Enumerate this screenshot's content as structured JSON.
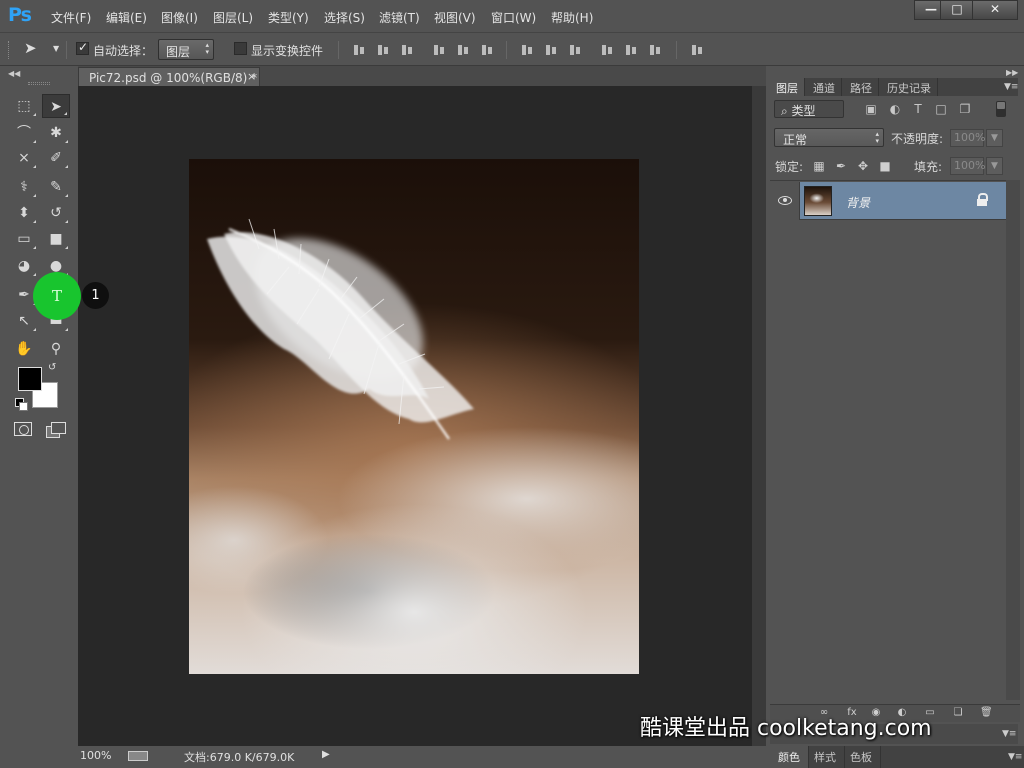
{
  "app": {
    "logo": "Ps"
  },
  "menu": [
    "文件(F)",
    "编辑(E)",
    "图像(I)",
    "图层(L)",
    "类型(Y)",
    "选择(S)",
    "滤镜(T)",
    "视图(V)",
    "窗口(W)",
    "帮助(H)"
  ],
  "window_controls": {
    "minimize": "—",
    "maximize": "□",
    "close": "✕"
  },
  "options": {
    "auto_select_label": "自动选择：",
    "auto_select_checked": true,
    "auto_select_target": "图层",
    "show_transform_label": "显示变换控件",
    "show_transform_checked": false
  },
  "document": {
    "tab_title": "Pic72.psd @ 100%(RGB/8) *",
    "tab_close": "×",
    "zoom": "100%",
    "doc_size": "文档:679.0 K/679.0K",
    "status_arrow": "▶"
  },
  "tools": [
    {
      "name": "rectangular-marquee-tool-icon",
      "glyph": "⬚"
    },
    {
      "name": "move-tool-icon",
      "glyph": "➤"
    },
    {
      "name": "lasso-tool-icon",
      "glyph": "⌒"
    },
    {
      "name": "magic-wand-tool-icon",
      "glyph": "✱"
    },
    {
      "name": "crop-tool-icon",
      "glyph": "⨯"
    },
    {
      "name": "eyedropper-tool-icon",
      "glyph": "✐"
    },
    {
      "name": "healing-brush-tool-icon",
      "glyph": "⚕"
    },
    {
      "name": "brush-tool-icon",
      "glyph": "✎"
    },
    {
      "name": "clone-stamp-tool-icon",
      "glyph": "⬍"
    },
    {
      "name": "history-brush-tool-icon",
      "glyph": "↺"
    },
    {
      "name": "eraser-tool-icon",
      "glyph": "▭"
    },
    {
      "name": "gradient-tool-icon",
      "glyph": "■"
    },
    {
      "name": "blur-tool-icon",
      "glyph": "◕"
    },
    {
      "name": "dodge-tool-icon",
      "glyph": "●"
    },
    {
      "name": "pen-tool-icon",
      "glyph": "✒"
    },
    {
      "name": "type-tool-icon",
      "glyph": "T"
    },
    {
      "name": "path-selection-tool-icon",
      "glyph": "↖"
    },
    {
      "name": "rectangle-tool-icon",
      "glyph": "▬"
    },
    {
      "name": "hand-tool-icon",
      "glyph": "✋"
    },
    {
      "name": "zoom-tool-icon",
      "glyph": "⚲"
    }
  ],
  "tutorial": {
    "highlight_glyph": "T",
    "step": "1"
  },
  "colors": {
    "foreground": "#000000",
    "background": "#ffffff",
    "selected_layer": "#6d87a3",
    "highlight": "#18c52e"
  },
  "layers_panel": {
    "tabs": [
      "图层",
      "通道",
      "路径",
      "历史记录"
    ],
    "filter_label": "⌕ 类型",
    "blend_mode": "正常",
    "opacity_label": "不透明度:",
    "opacity_value": "100%",
    "lock_label": "锁定:",
    "fill_label": "填充:",
    "fill_value": "100%",
    "layers": [
      {
        "name": "背景",
        "visible": true,
        "locked": true
      }
    ]
  },
  "bottom_panel": {
    "tabs": [
      "颜色",
      "样式",
      "色板"
    ]
  },
  "watermark": "酷课堂出品 coolketang.com"
}
